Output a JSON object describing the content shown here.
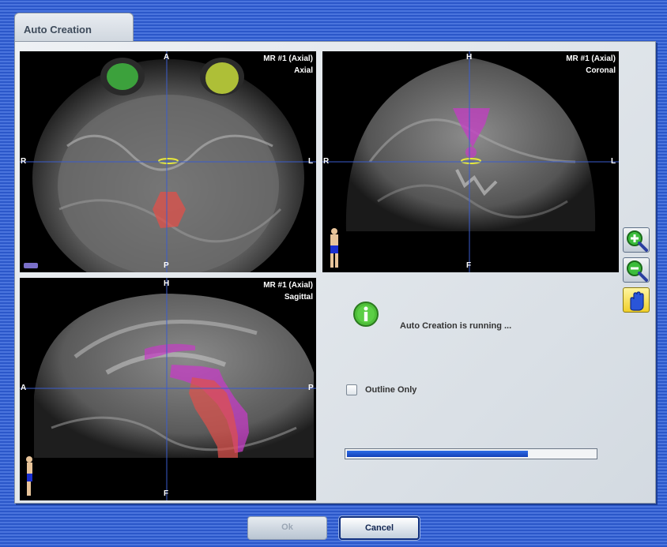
{
  "tab": {
    "title": "Auto Creation"
  },
  "views": {
    "axial": {
      "series": "MR #1 (Axial)",
      "plane": "Axial",
      "top": "A",
      "bottom": "P",
      "left": "R",
      "right": "L"
    },
    "coronal": {
      "series": "MR #1 (Axial)",
      "plane": "Coronal",
      "top": "H",
      "bottom": "F",
      "left": "R",
      "right": "L"
    },
    "sagittal": {
      "series": "MR #1 (Axial)",
      "plane": "Sagittal",
      "top": "H",
      "bottom": "F",
      "left": "A",
      "right": "P"
    }
  },
  "tools": {
    "zoom_in": "zoom-in-icon",
    "zoom_out": "zoom-out-icon",
    "pan": "hand-icon"
  },
  "status": {
    "message": "Auto Creation is running ..."
  },
  "outline_only": {
    "label": "Outline Only",
    "checked": false
  },
  "progress": {
    "fraction": 0.73
  },
  "buttons": {
    "ok": "Ok",
    "cancel": "Cancel"
  },
  "colors": {
    "background_stripe": "#2b57c9",
    "structure_green": "#3fb63f",
    "structure_yellow": "#c6d93a",
    "structure_red": "#e0504a",
    "structure_magenta": "#c43cc4",
    "crosshair": "#3a5ccc",
    "progress": "#1e55d0"
  }
}
